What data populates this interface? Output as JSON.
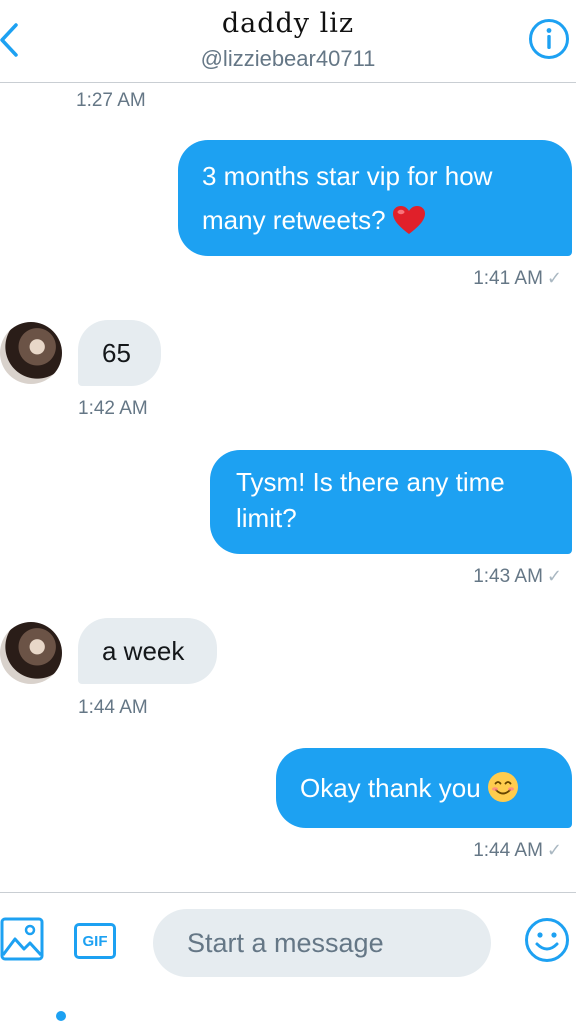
{
  "header": {
    "title": "daddy liz",
    "handle": "@lizziebear40711"
  },
  "conversation": [
    {
      "type": "timestamp",
      "text": "1:27 AM"
    },
    {
      "type": "sent",
      "text": "3 months star vip for how many retweets?",
      "emoji": "heart-emoji",
      "timestamp": "1:41 AM"
    },
    {
      "type": "received",
      "text": "65",
      "timestamp": "1:42 AM"
    },
    {
      "type": "sent",
      "text": "Tysm! Is there any time limit?",
      "timestamp": "1:43 AM"
    },
    {
      "type": "received",
      "text": "a week",
      "timestamp": "1:44 AM"
    },
    {
      "type": "sent",
      "text": "Okay thank you",
      "emoji": "smiling-face-emoji",
      "timestamp": "1:44 AM"
    }
  ],
  "composer": {
    "gif_label": "GIF",
    "placeholder": "Start a message"
  },
  "colors": {
    "accent": "#1da1f2",
    "received_bubble": "#e6ecf0",
    "secondary_text": "#657786"
  }
}
